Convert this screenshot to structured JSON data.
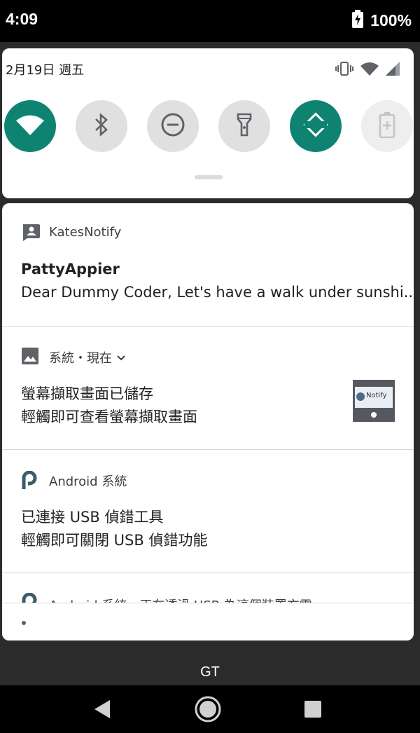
{
  "status_bar": {
    "time": "4:09",
    "battery_percent": "100%",
    "icons": [
      "battery-charging-icon"
    ]
  },
  "quick_settings": {
    "date": "2月19日 週五",
    "status_icons": [
      "vibrate-icon",
      "wifi-icon",
      "cellular-signal-icon"
    ],
    "tiles": [
      {
        "icon": "wifi-icon",
        "state": "on"
      },
      {
        "icon": "bluetooth-icon",
        "state": "off"
      },
      {
        "icon": "do-not-disturb-icon",
        "state": "off"
      },
      {
        "icon": "flashlight-icon",
        "state": "off"
      },
      {
        "icon": "auto-rotate-icon",
        "state": "on"
      },
      {
        "icon": "battery-saver-icon",
        "state": "disabled"
      }
    ],
    "accent_color": "#0f8372"
  },
  "notifications": [
    {
      "app": "KatesNotify",
      "icon": "contact-card-icon",
      "title": "PattyAppier",
      "text": "Dear Dummy Coder, Let's have a walk under sunshi.."
    },
    {
      "app": "系統・現在",
      "icon": "image-icon",
      "title": "螢幕擷取畫面已儲存",
      "text": "輕觸即可查看螢幕擷取畫面",
      "thumbnail_label": "Notify"
    },
    {
      "app": "Android 系統",
      "icon": "android-p-icon",
      "title": "已連接 USB 偵錯工具",
      "text": "輕觸即可關閉 USB 偵錯功能"
    },
    {
      "app": "Android 系統・正在透過 USB 為這個裝置充電",
      "icon": "android-p-icon"
    }
  ],
  "carrier_label": "GT",
  "nav_bar": {
    "buttons": [
      "back-icon",
      "home-icon",
      "recents-icon"
    ]
  }
}
